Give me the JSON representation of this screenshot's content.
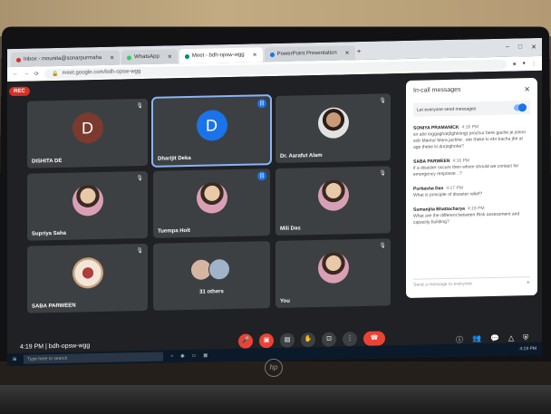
{
  "browser": {
    "tabs": [
      {
        "label": "Inbox - mounita@sonarpurmaha",
        "color": "#d93025"
      },
      {
        "label": "WhatsApp",
        "color": "#25d366"
      },
      {
        "label": "Meet - bdh-opsw-wgg",
        "color": "#00897b"
      },
      {
        "label": "PowerPoint Presentation",
        "color": "#1a73e8"
      }
    ],
    "url": "meet.google.com/bdh-opsw-wgg"
  },
  "meet": {
    "rec_label": "REC",
    "tiles": [
      {
        "name": "DISHITA DE",
        "kind": "letter",
        "letter": "D",
        "color": "#7b3a2e",
        "speaking": false
      },
      {
        "name": "Dharijit Deka",
        "kind": "letter",
        "letter": "D",
        "color": "#1a73e8",
        "speaking": true
      },
      {
        "name": "Dr. Aarafut Alam",
        "kind": "photo",
        "style": "man",
        "speaking": false
      },
      {
        "name": "Supriya Saha",
        "kind": "photo",
        "style": "woman",
        "speaking": false
      },
      {
        "name": "Tuempa Holt",
        "kind": "photo",
        "style": "woman",
        "speaking": true
      },
      {
        "name": "Mili Das",
        "kind": "photo",
        "style": "woman",
        "speaking": false
      },
      {
        "name": "SABA PARWEEN",
        "kind": "photo",
        "style": "food",
        "speaking": false
      },
      {
        "name": "31 others",
        "kind": "others",
        "speaking": false
      },
      {
        "name": "You",
        "kind": "photo",
        "style": "woman",
        "speaking": false
      }
    ],
    "meeting_time": "4:19 PM",
    "meeting_code": "bdh-opsw-wgg"
  },
  "panel": {
    "title": "In-call messages",
    "toggle_label": "Let everyone send messages",
    "messages": [
      {
        "sender": "SONIYA PRAMANICK",
        "time": "4:16 PM",
        "text": "sir alto toggaghat(lightning) prochur bere gache je jonno sob Mantur Mara jachhe . ete theke ki ebr bacha jbe ar age theke ki durjoghoke?"
      },
      {
        "sender": "SABA PARWEEN",
        "time": "4:16 PM",
        "text": "if a disaster occurs then whom should we contact for emergency response ..?"
      },
      {
        "sender": "Purbasha Das",
        "time": "4:17 PM",
        "text": "What is principle of disaster relief?"
      },
      {
        "sender": "Sumanjita Bhattacharya",
        "time": "4:18 PM",
        "text": "What are the different between Risk assessment and capacity building?"
      }
    ],
    "input_placeholder": "Send a message to everyone"
  },
  "taskbar": {
    "search_placeholder": "Type here to search",
    "clock": "4:19 PM"
  },
  "laptop": {
    "brand": "hp"
  }
}
